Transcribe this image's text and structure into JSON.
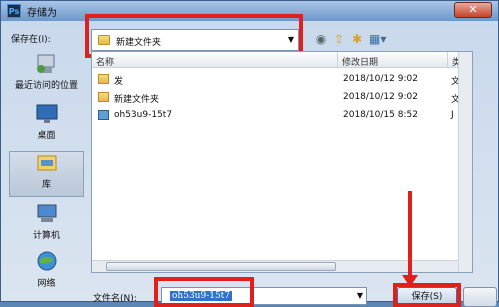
{
  "window": {
    "title": "存储为",
    "app_icon": "Ps"
  },
  "toolbar": {
    "save_in_label": "保存在(I):",
    "current_folder": "新建文件夹",
    "icons": [
      "back-icon",
      "up-folder-icon",
      "new-folder-icon",
      "views-icon"
    ]
  },
  "places": [
    {
      "label": "最近访问的位置",
      "icon": "recent-places-icon"
    },
    {
      "label": "桌面",
      "icon": "desktop-icon"
    },
    {
      "label": "库",
      "icon": "libraries-icon"
    },
    {
      "label": "计算机",
      "icon": "computer-icon"
    },
    {
      "label": "网络",
      "icon": "network-icon"
    }
  ],
  "filelist": {
    "columns": [
      "名称",
      "修改日期",
      "类"
    ],
    "rows": [
      {
        "name": "发",
        "date": "2018/10/12 9:02",
        "type": "文",
        "icon": "folder-icon"
      },
      {
        "name": "新建文件夹",
        "date": "2018/10/12 9:02",
        "type": "文",
        "icon": "folder-icon"
      },
      {
        "name": "oh53u9-15t7",
        "date": "2018/10/15 8:52",
        "type": "J",
        "icon": "image-file-icon"
      }
    ]
  },
  "footer": {
    "filename_label": "文件名(N):",
    "filename_value": "oh53u9-15t7",
    "save_button": "保存(S)"
  },
  "colors": {
    "highlight": "#e0201a",
    "selection": "#3072c4"
  }
}
